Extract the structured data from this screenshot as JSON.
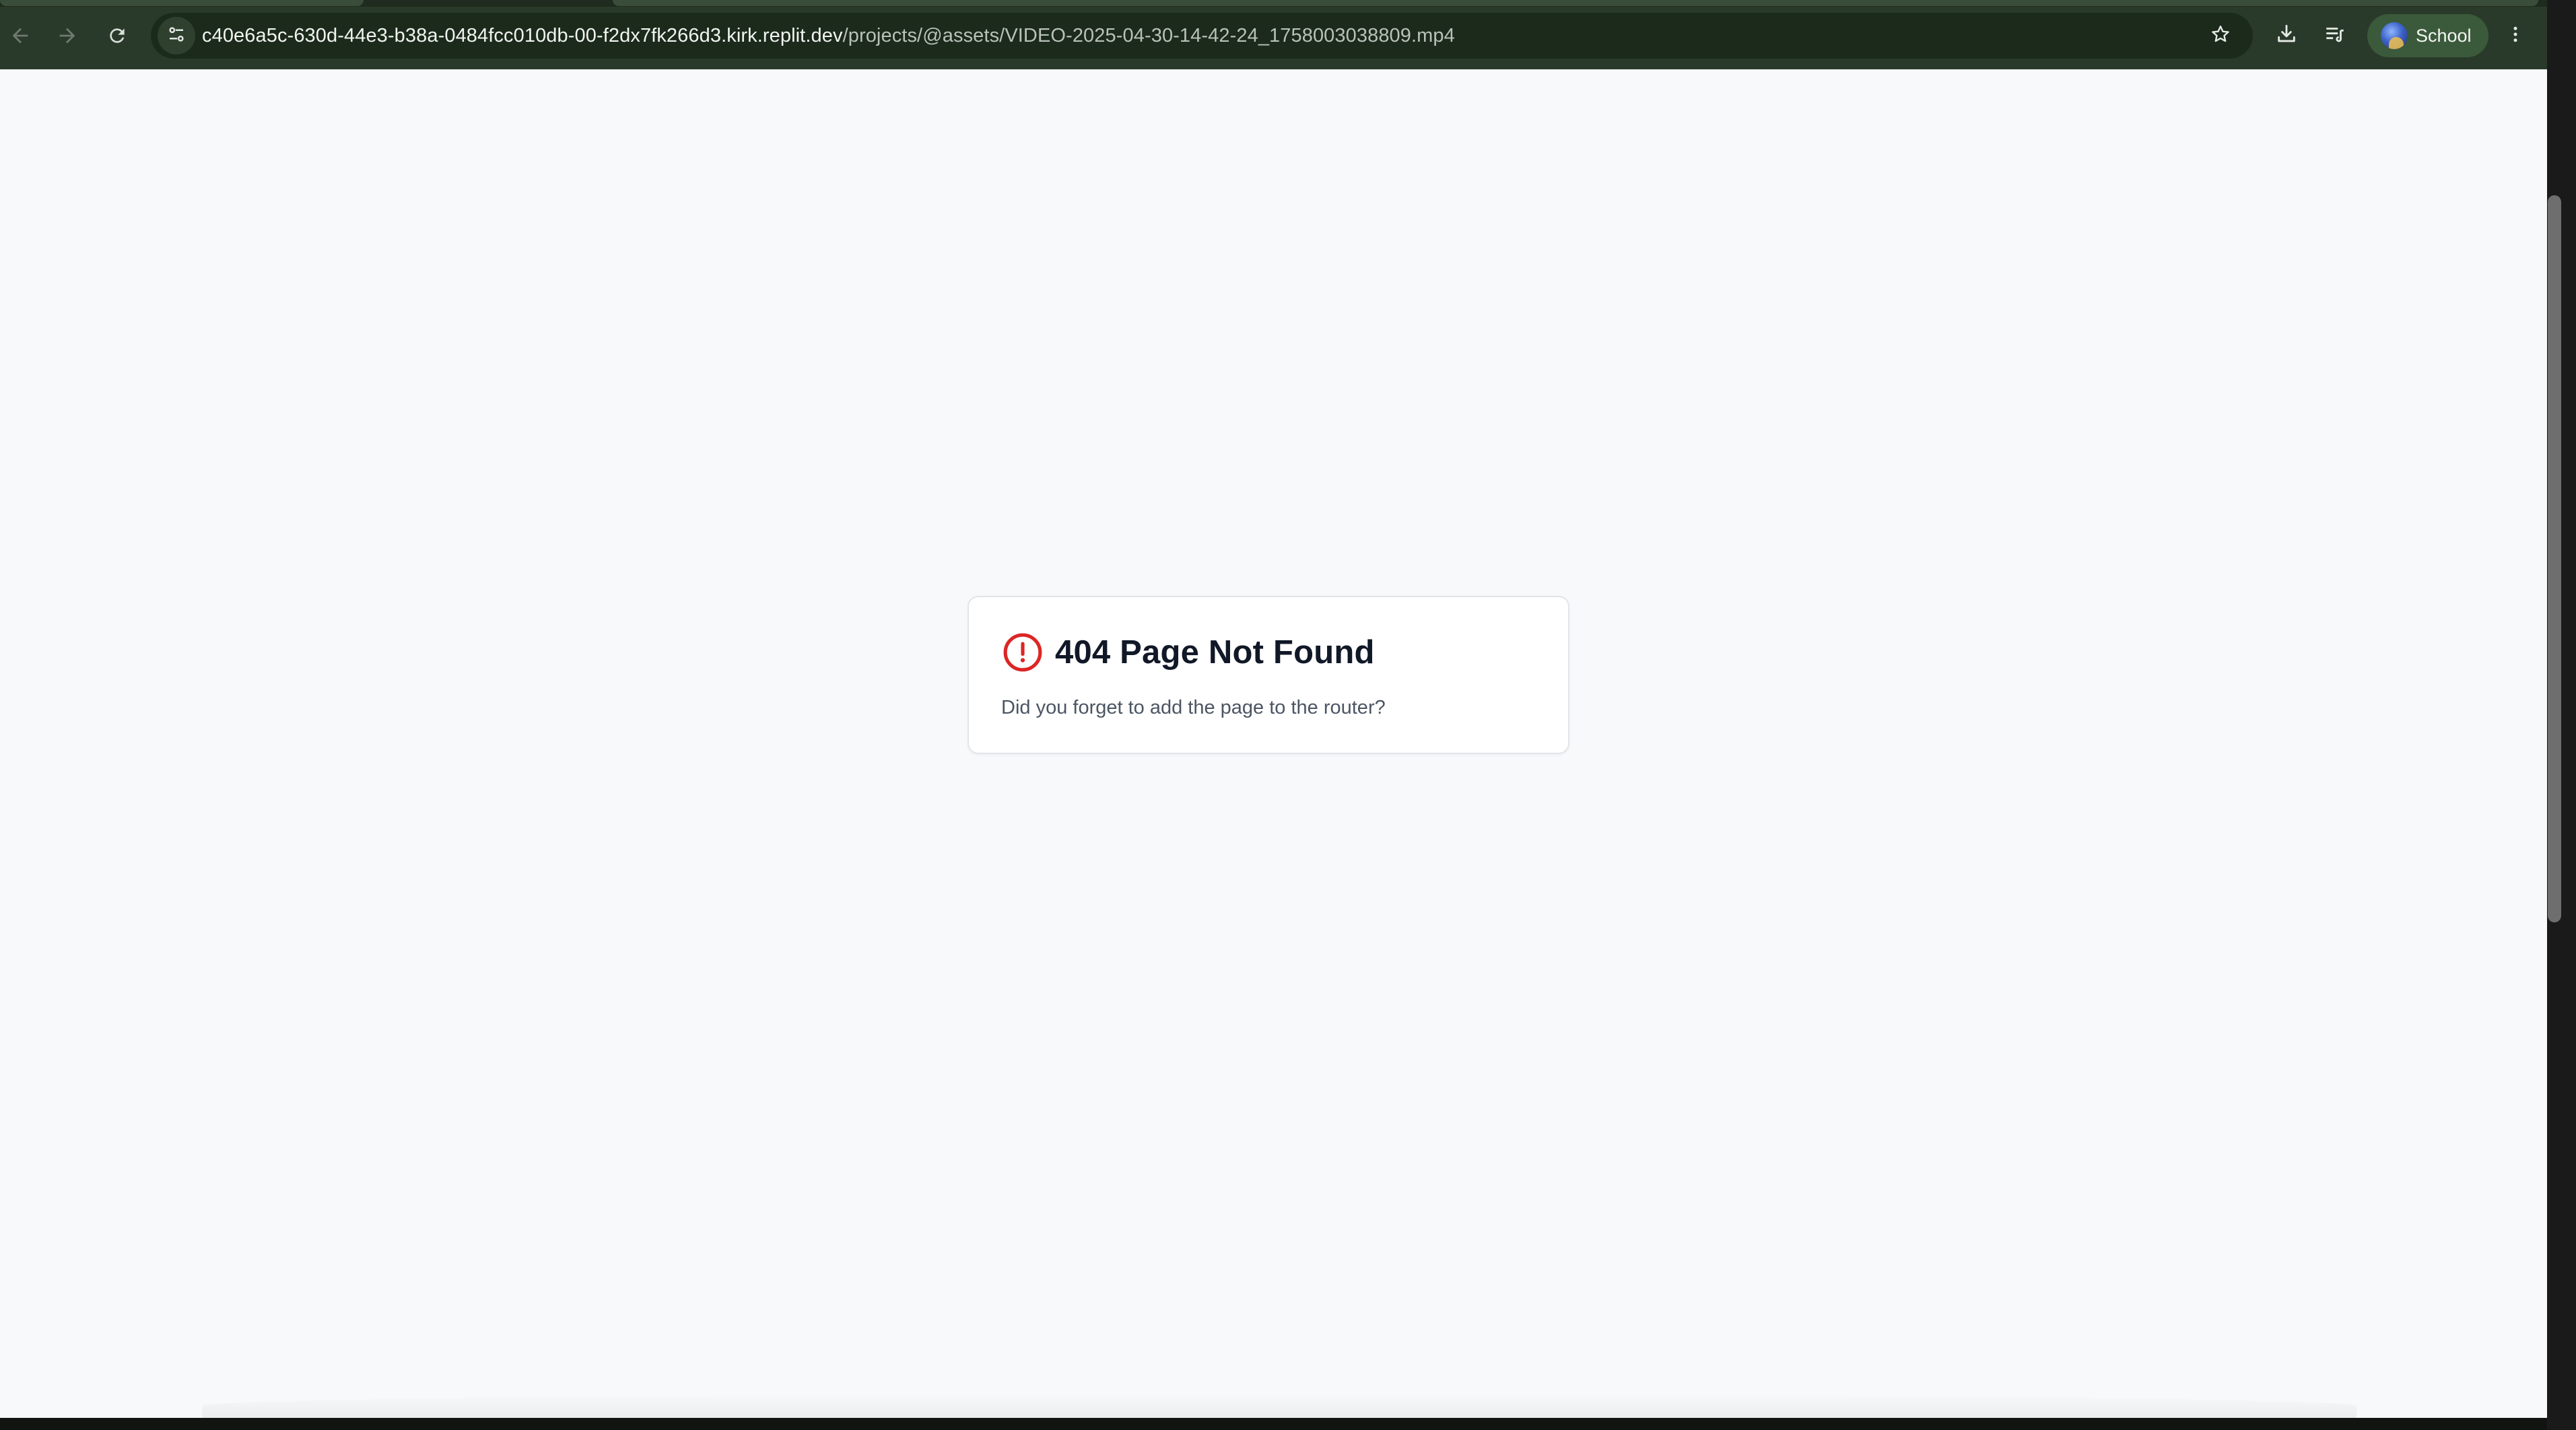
{
  "browser": {
    "url_host": "c40e6a5c-630d-44e3-b38a-0484fcc010db-00-f2dx7fk266d3.kirk.replit.dev",
    "url_path": "/projects/@assets/VIDEO-2025-04-30-14-42-24_1758003038809.mp4",
    "profile_label": "School",
    "icons": {
      "back": "back-arrow-icon",
      "forward": "forward-arrow-icon",
      "reload": "reload-icon",
      "site_info": "site-info-icon",
      "bookmark": "star-icon",
      "downloads": "download-icon",
      "reading_list": "reading-list-icon",
      "menu": "more-vertical-icon"
    },
    "colors": {
      "toolbar": "#2a3a2a",
      "omnibox": "#1b2a1b",
      "profile_chip": "#3b5a3b"
    }
  },
  "page": {
    "title": "404 Page Not Found",
    "message": "Did you forget to add the page to the router?",
    "icon": "alert-circle-icon",
    "colors": {
      "background": "#f8f9fb",
      "alert": "#dc2626",
      "title": "#111827",
      "text": "#4b5563"
    }
  }
}
